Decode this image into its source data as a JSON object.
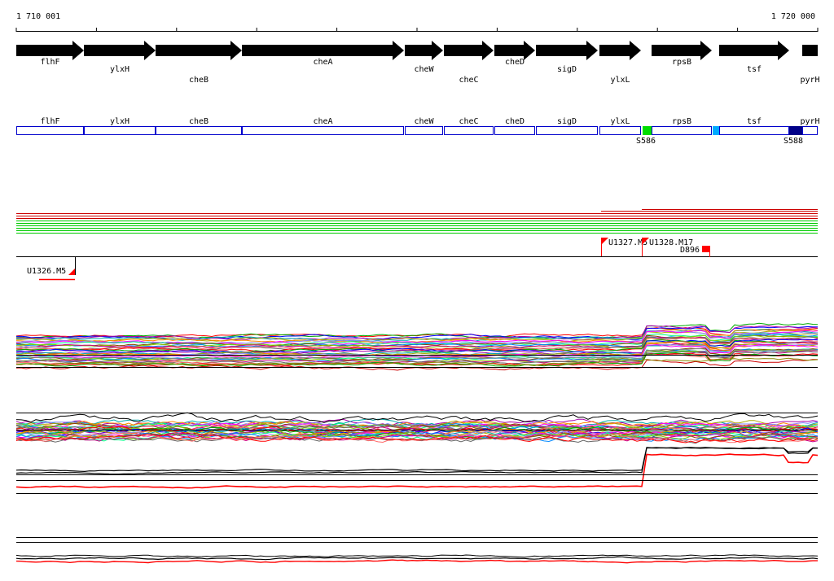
{
  "ruler": {
    "start_label": "1 710 001",
    "end_label": "1 720 000"
  },
  "genes": [
    {
      "name": "flhF",
      "start": 20,
      "end": 103,
      "label_row": 0
    },
    {
      "name": "ylxH",
      "start": 103,
      "end": 191,
      "label_row": 1
    },
    {
      "name": "cheB",
      "start": 191,
      "end": 297,
      "label_row": 2
    },
    {
      "name": "cheA",
      "start": 297,
      "end": 496,
      "label_row": 0
    },
    {
      "name": "cheW",
      "start": 497,
      "end": 544,
      "label_row": 1
    },
    {
      "name": "cheC",
      "start": 545,
      "end": 606,
      "label_row": 2
    },
    {
      "name": "cheD",
      "start": 607,
      "end": 657,
      "label_row": 0
    },
    {
      "name": "sigD",
      "start": 658,
      "end": 734,
      "label_row": 1
    },
    {
      "name": "ylxL",
      "start": 736,
      "end": 787,
      "label_row": 2
    },
    {
      "name": "rpsB",
      "start": 800,
      "end": 874,
      "label_row": 0
    },
    {
      "name": "tsf",
      "start": 883,
      "end": 969,
      "label_row": 1
    },
    {
      "name": "pyrH",
      "start": 985,
      "end": 1004,
      "label_row": 2
    }
  ],
  "segments": [
    {
      "name": "flhF",
      "start": 20,
      "end": 103
    },
    {
      "name": "ylxH",
      "start": 103,
      "end": 191
    },
    {
      "name": "cheB",
      "start": 191,
      "end": 297
    },
    {
      "name": "cheA",
      "start": 297,
      "end": 496
    },
    {
      "name": "cheW",
      "start": 497,
      "end": 544
    },
    {
      "name": "cheC",
      "start": 545,
      "end": 606
    },
    {
      "name": "cheD",
      "start": 607,
      "end": 657
    },
    {
      "name": "sigD",
      "start": 658,
      "end": 734
    },
    {
      "name": "ylxL",
      "start": 736,
      "end": 787
    },
    {
      "name": "rpsB",
      "start": 800,
      "end": 874
    },
    {
      "name": "tsf",
      "start": 883,
      "end": 969
    },
    {
      "name": "pyrH",
      "start": 985,
      "end": 1004
    }
  ],
  "markers": [
    {
      "label": "S586",
      "color": "#00dd00"
    },
    {
      "label": "",
      "color": "#00aaff"
    },
    {
      "label": "S588",
      "color": "#000088"
    }
  ],
  "features": [
    {
      "label": "U1327.M5"
    },
    {
      "label": "U1328.M17"
    },
    {
      "label": "D896"
    },
    {
      "label": "U1326.M5"
    }
  ],
  "colors": {
    "gene": "#000000",
    "segment_outline": "#0000cc",
    "feature": "#ff0000",
    "upper_lines": "#00cc00",
    "upper_red": "#cc0000"
  }
}
